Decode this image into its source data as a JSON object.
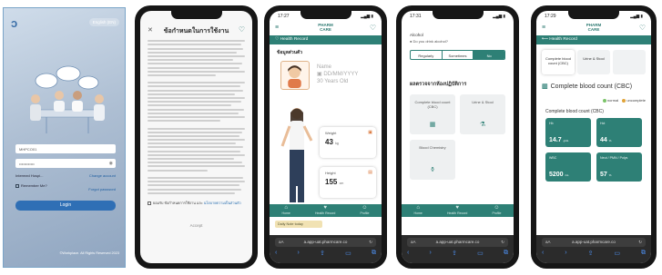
{
  "login": {
    "lang": "English (EN)",
    "username_value": "MHPCO01",
    "password_value": "••••••••••••",
    "hospital_label": "Intermed Hospi...",
    "change_account": "Change account",
    "remember_label": "Remember Me?",
    "forgot_password": "Forgot password",
    "login_button": "Login",
    "footer": "©Workplace. All Rights Reserved 2023"
  },
  "phone_terms": {
    "title": "ข้อกำหนดในการใช้งาน",
    "consent_text": "ยอมรับ ข้อกำหนดการใช้งาน และ",
    "consent_link": "นโยบายความเป็นส่วนตัว",
    "accept_button": "Accept"
  },
  "phone_info": {
    "time": "17:27",
    "brand_line1": "PHARM",
    "brand_line2": "CARE",
    "strip": "Health Record",
    "section": "ข้อมูลส่วนตัว",
    "name": "Name",
    "dob": "DD/MM/YYYY",
    "age": "30 Years Old",
    "weight_label": "Weight",
    "weight_value": "43",
    "weight_unit": "kg",
    "height_label": "Height",
    "height_value": "155",
    "height_unit": "cm",
    "daily": "Daily Note today",
    "url": "a.app-uat.pharmcare.co"
  },
  "phone_tests": {
    "time": "17:31",
    "alcohol_title": "Alcohol",
    "alcohol_q": "Do you drink alcohol?",
    "options": [
      "Regularly",
      "Sometimes",
      "No"
    ],
    "section": "ผลตรวจจากห้องปฏิบัติการ",
    "tiles": [
      "Complete blood count (CBC)",
      "Urine & Stool",
      "Blood Chemistry"
    ],
    "url": "a.app-uat.pharmcare.co"
  },
  "phone_cbc": {
    "time": "17:29",
    "back": "Health Record",
    "chips": [
      "Complete blood count (CBC)",
      "Urine & Stool",
      ""
    ],
    "heading": "Complete blood count (CBC)",
    "legend": [
      "normal",
      "uncomplete"
    ],
    "sub": "Complete blood count (CBC)",
    "cards": [
      {
        "k": "Hb",
        "v": "14.7",
        "u": "g/dL"
      },
      {
        "k": "Hct",
        "v": "44",
        "u": "%"
      },
      {
        "k": "WBC",
        "v": "5200",
        "u": "/uL"
      },
      {
        "k": "Neut / PMN / Polys",
        "v": "57",
        "u": "%"
      }
    ],
    "url": "a.app-uat.pharmcare.co"
  },
  "bottom_nav": [
    "Home",
    "Health Record",
    "Profile"
  ],
  "colors": {
    "brand": "#2e8076",
    "login_button": "#2f6fb5"
  }
}
